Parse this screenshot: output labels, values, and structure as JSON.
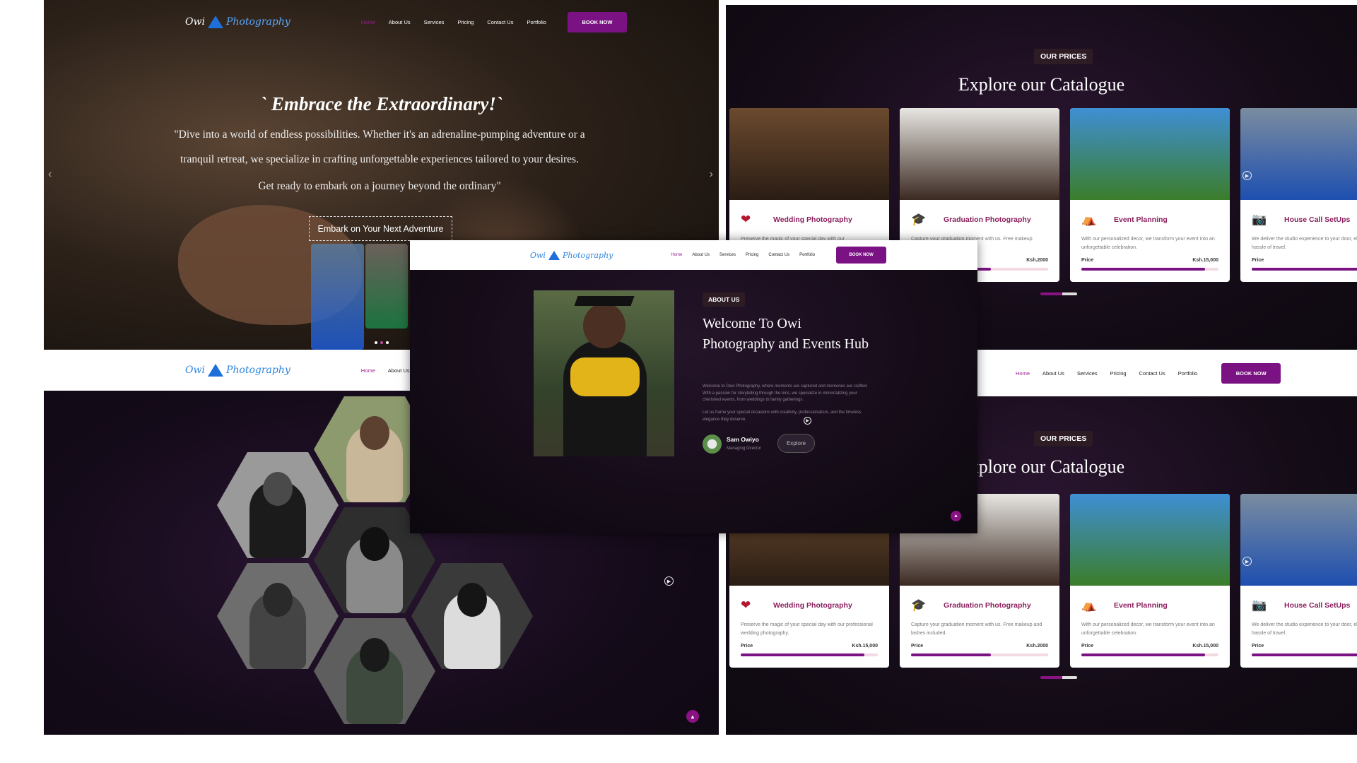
{
  "brand": {
    "logo_text_left": "Owi",
    "logo_text_right": "Photography"
  },
  "nav": {
    "items": [
      "Home",
      "About Us",
      "Services",
      "Pricing",
      "Contact Us",
      "Portfolio"
    ],
    "book": "BOOK NOW"
  },
  "hero": {
    "title": "` Embrace the Extraordinary!`",
    "line1": "\"Dive into a world of endless possibilities. Whether it's an adrenaline-pumping adventure or a",
    "line2": "tranquil retreat, we specialize in crafting unforgettable experiences tailored to your desires.",
    "line3": "Get ready to embark on a journey beyond the ordinary\"",
    "cta": "Embark on Your Next Adventure",
    "prev_icon": "chevron-left-icon",
    "next_icon": "chevron-right-icon",
    "slides_total": 3,
    "slide_active": 1
  },
  "catalogue": {
    "badge": "OUR PRICES",
    "title": "Explore our Catalogue",
    "price_label": "Price",
    "cards": [
      {
        "title": "Wedding Photography",
        "icon": "heart-icon",
        "desc_top": "Preserve the magic of your special day with our",
        "desc": "Preserve the magic of your special day with our professional wedding photography.",
        "price": "Ksh.15,000",
        "fill": 0.9,
        "colors": [
          "#6b4a2e",
          "#2a1d14"
        ]
      },
      {
        "title": "Graduation Photography",
        "icon": "graduation-cap-icon",
        "desc_top": "Capture your graduation moment with us. Free makeup",
        "desc": "Capture your graduation moment with us. Free makeup and lashes included.",
        "price": "Ksh.2000",
        "fill": 0.58,
        "colors": [
          "#e8e6e2",
          "#3b2a22"
        ]
      },
      {
        "title": "Event Planning",
        "icon": "tent-icon",
        "desc_top": "With our personalized decor, we transform your event into an unforgettable celebration.",
        "desc": "With our personalized decor, we transform your event into an unforgettable celebration.",
        "price": "Ksh.15,000",
        "fill": 0.9,
        "colors": [
          "#3f8fd4",
          "#3b7d2a"
        ]
      },
      {
        "title": "House Call SetUps",
        "icon": "camera-icon",
        "desc_top": "We deliver the studio experience to your door, eliminating the hassle of travel.",
        "desc": "We deliver the studio experience to your door, eliminating the hassle of travel.",
        "price": "",
        "fill": 0.85,
        "colors": [
          "#7a8ca0",
          "#1e4fb0"
        ]
      }
    ]
  },
  "about": {
    "badge": "ABOUT US",
    "title": "Welcome To Owi Photography and Events Hub",
    "p1": "Welcome to Owo Photography, where moments are captured and memories are crafted. With a passion for storytelling through the lens, we specialize in immortalizing your cherished events, from weddings to family gatherings.",
    "p2": "Let us frame your special occasions with creativity, professionalism, and the timeless elegance they deserve.",
    "owner_name": "Sam Owiyo",
    "owner_role": "Managing Director",
    "explore": "Explore"
  },
  "scroll_top_icon": "arrow-up-icon",
  "colors": {
    "accent": "#7b1283",
    "active_link": "#9b1c8f",
    "dark_bg": "#140c17",
    "card_title": "#8a1f5d"
  }
}
